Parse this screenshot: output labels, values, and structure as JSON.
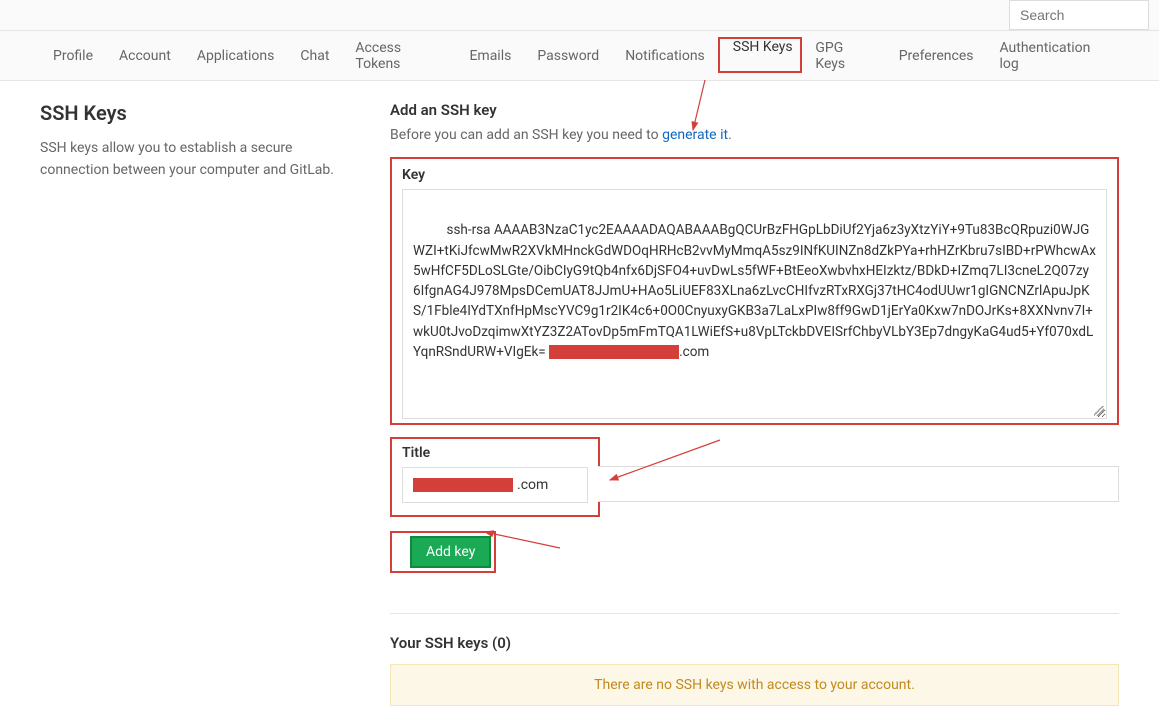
{
  "search": {
    "placeholder": "Search"
  },
  "nav": {
    "tabs": [
      {
        "label": "Profile"
      },
      {
        "label": "Account"
      },
      {
        "label": "Applications"
      },
      {
        "label": "Chat"
      },
      {
        "label": "Access Tokens"
      },
      {
        "label": "Emails"
      },
      {
        "label": "Password"
      },
      {
        "label": "Notifications"
      },
      {
        "label": "SSH Keys",
        "active": true
      },
      {
        "label": "GPG Keys"
      },
      {
        "label": "Preferences"
      },
      {
        "label": "Authentication log"
      }
    ]
  },
  "sidebar": {
    "title": "SSH Keys",
    "description": "SSH keys allow you to establish a secure connection between your computer and GitLab."
  },
  "form": {
    "heading": "Add an SSH key",
    "helper_prefix": "Before you can add an SSH key you need to ",
    "helper_link": "generate it",
    "helper_suffix": ".",
    "key_label": "Key",
    "key_value": "ssh-rsa AAAAB3NzaC1yc2EAAAADAQABAAABgQCUrBzFHGpLbDiUf2Yja6z3yXtzYiY+9Tu83BcQRpuzi0WJGWZI+tKiJfcwMwR2XVkMHnckGdWDOqHRHcB2vvMyMmqA5sz9INfKUINZn8dZkPYa+rhHZrKbru7sIBD+rPWhcwAx5wHfCF5DLoSLGte/OibCIyG9tQb4nfx6DjSFO4+uvDwLs5fWF+BtEeoXwbvhxHEIzktz/BDkD+IZmq7LI3cneL2Q07zy6IfgnAG4J978MpsDCemUAT8JJmU+HAo5LiUEF83XLna6zLvcCHIfvzRTxRXGj37tHC4odUUwr1gIGNCNZrlApuJpKS/1Fble4IYdTXnfHpMscYVC9g1r2IK4c6+0O0CnyuxyGKB3a7LaLxPIw8ff9GwD1jErYa0Kxw7nDOJrKs+8XXNvnv7I+wkU0tJvoDzqimwXtYZ3Z2ATovDp5mFmTQA1LWiEfS+u8VpLTckbDVEISrfChbyVLbY3Ep7dngyKaG4ud5+Yf070xdLYqnRSndURW+VIgEk=",
    "key_domain_suffix": ".com",
    "title_label": "Title",
    "title_suffix": ".com",
    "submit_label": "Add key"
  },
  "list": {
    "heading": "Your SSH keys (0)",
    "empty_message": "There are no SSH keys with access to your account."
  }
}
